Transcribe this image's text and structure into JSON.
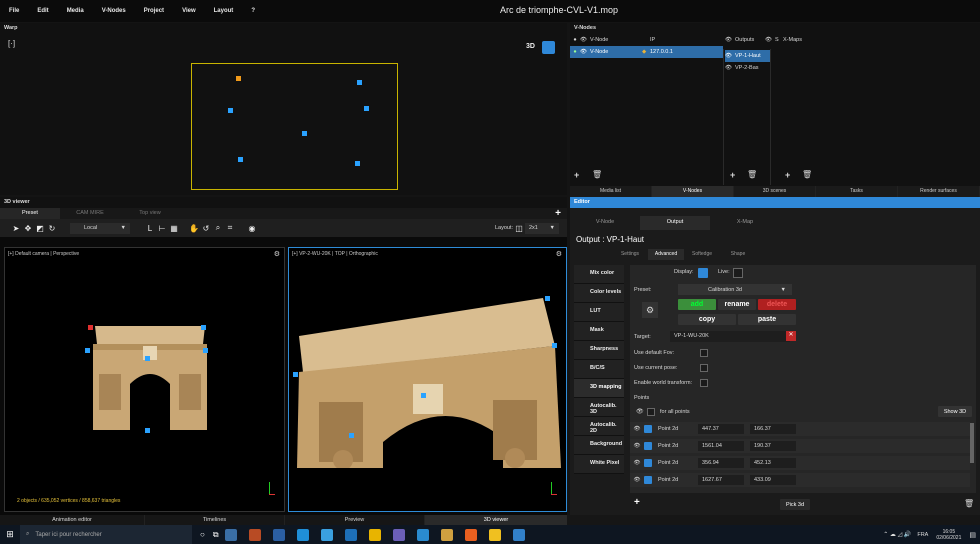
{
  "menu": [
    "File",
    "Edit",
    "Media",
    "V-Nodes",
    "Project",
    "View",
    "Layout",
    "?"
  ],
  "window_title": "Arc de triomphe-CVL-V1.mop",
  "warp": {
    "title": "Warp",
    "btn3d_label": "3D"
  },
  "vnodes": {
    "title": "V-Nodes",
    "col_vnode": "V-Node",
    "col_ip": "IP",
    "col_outputs": "Outputs",
    "col_s": "S",
    "col_xmaps": "X-Maps",
    "row_name": "V-Node",
    "row_ip": "127.0.0.1",
    "outputs": [
      "VP-1-Haut",
      "VP-2-Bas"
    ],
    "tabs": [
      "Media list",
      "V-Nodes",
      "3D scenes",
      "Tasks",
      "Render surfaces"
    ]
  },
  "viewer": {
    "title": "3D viewer",
    "tabs": [
      "Preset",
      "CAM MIRE",
      "Top view"
    ],
    "space": "Local",
    "layout_label": "Layout:",
    "layout_value": "2x1",
    "vp1_title": "[+] Default camera | Perspective",
    "vp2_title": "[+] VP-2-WU-20K | TOP | Orthographic",
    "stats": "2 objects / 635,052 vertices / 858,637 triangles"
  },
  "editor": {
    "title": "Editor",
    "top_tabs": [
      "V-Node",
      "Output",
      "X-Map"
    ],
    "output_title": "Output : VP-1-Haut",
    "sub_tabs": [
      "Settings",
      "Advanced",
      "Softedge",
      "Shape"
    ],
    "nav": [
      "Mix color",
      "Color levels",
      "LUT",
      "Mask",
      "Sharpness",
      "B/C/S",
      "3D mapping",
      "Autocalib. 3D",
      "Autocalib. 2D",
      "Background",
      "White Pixel"
    ],
    "display_label": "Display:",
    "live_label": "Live:",
    "preset_label": "Preset:",
    "preset_value": "Calibration 3d",
    "btn_add": "add",
    "btn_rename": "rename",
    "btn_delete": "delete",
    "btn_copy": "copy",
    "btn_paste": "paste",
    "target_label": "Target:",
    "target_value": "VP-1-WU-20K",
    "use_default_fov": "Use default Fov:",
    "use_current_pose": "Use current pose:",
    "enable_world": "Enable world transform:",
    "points_label": "Points",
    "for_all_points": "for all points",
    "show3d": "Show 3D",
    "pick3d": "Pick 3d",
    "points": [
      {
        "name": "Point 2d",
        "x": "447.37",
        "y": "166.37"
      },
      {
        "name": "Point 2d",
        "x": "1561.04",
        "y": "190.37"
      },
      {
        "name": "Point 2d",
        "x": "356.94",
        "y": "452.13"
      },
      {
        "name": "Point 2d",
        "x": "1627.67",
        "y": "433.09"
      }
    ]
  },
  "bottom_tabs": [
    "Animation editor",
    "Timelines",
    "Preview",
    "3D viewer"
  ],
  "taskbar": {
    "search": "Taper ici pour rechercher",
    "lang": "FRA",
    "time": "16:05",
    "date": "02/06/2021"
  }
}
